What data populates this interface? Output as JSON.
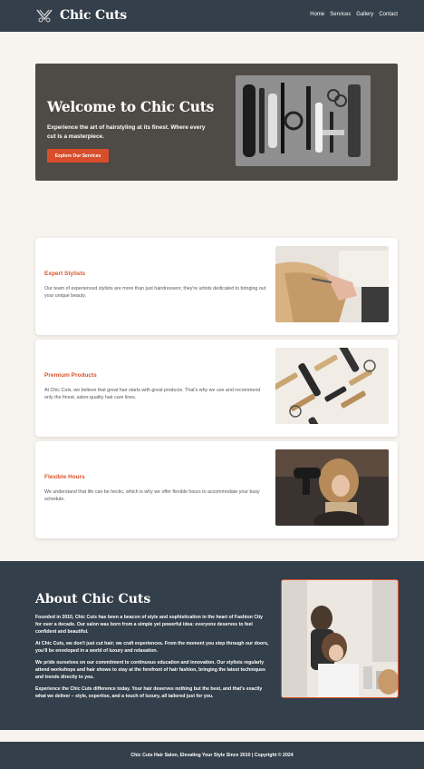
{
  "header": {
    "brand": "Chic Cuts",
    "nav": [
      "Home",
      "Services",
      "Gallery",
      "Contact"
    ]
  },
  "hero": {
    "title": "Welcome to Chic Cuts",
    "subtitle": "Experience the art of hairstyling at its finest. Where every cut is a masterpiece.",
    "cta": "Explore Our Services"
  },
  "features": [
    {
      "title": "Expert Stylists",
      "text": "Our team of experienced stylists are more than just hairdressers; they're artists dedicated to bringing out your unique beauty."
    },
    {
      "title": "Premium Products",
      "text": "At Chic Cuts, we believe that great hair starts with great products. That's why we use and recommend only the finest, salon-quality hair care lines."
    },
    {
      "title": "Flexible Hours",
      "text": "We understand that life can be hectic, which is why we offer flexible hours to accommodate your busy schedule."
    }
  ],
  "about": {
    "title": "About Chic Cuts",
    "paragraphs": [
      "Founded in 2010, Chic Cuts has been a beacon of style and sophistication in the heart of Fashion City for over a decade. Our salon was born from a simple yet powerful idea: everyone deserves to feel confident and beautiful.",
      "At Chic Cuts, we don't just cut hair; we craft experiences. From the moment you step through our doors, you'll be enveloped in a world of luxury and relaxation.",
      "We pride ourselves on our commitment to continuous education and innovation. Our stylists regularly attend workshops and hair shows to stay at the forefront of hair fashion, bringing the latest techniques and trends directly to you.",
      "Experience the Chic Cuts difference today. Your hair deserves nothing but the best, and that's exactly what we deliver – style, expertise, and a touch of luxury, all tailored just for you."
    ]
  },
  "footer": {
    "text": "Chic Cuts Hair Salon, Elevating Your Style Since 2010 | Copyright © 2024"
  },
  "colors": {
    "dark": "#333f4a",
    "accent": "#d84d2a",
    "background": "#f7f3ee",
    "hero_bg": "#4e4a46"
  },
  "icons": [
    "scissors-comb-logo-icon"
  ]
}
